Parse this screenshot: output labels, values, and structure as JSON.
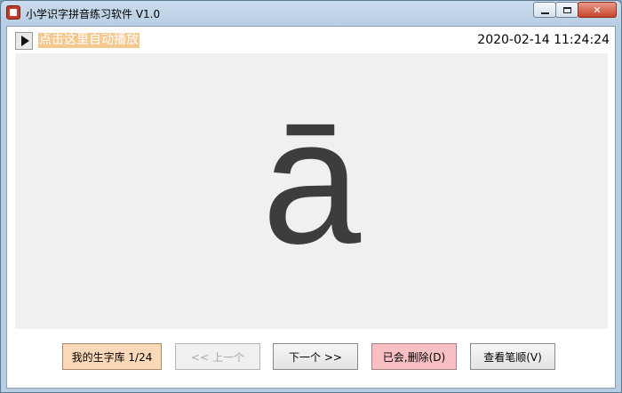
{
  "window": {
    "title": "小学识字拼音练习软件 V1.0",
    "close_glyph": "✕"
  },
  "toolbar": {
    "autoplay_label": "点击这里自动播放",
    "datetime": "2020-02-14 11:24:24"
  },
  "display": {
    "pinyin": "ā"
  },
  "buttons": {
    "word_bank": "我的生字库 1/24",
    "prev": "<< 上一个",
    "next": "下一个 >>",
    "learned_delete": "已会,删除(D)",
    "stroke_order": "查看笔顺(V)"
  },
  "colors": {
    "autoplay_bg": "#f4c98f",
    "word_bank_bg": "#fbd9b8",
    "delete_bg": "#f8c0c3",
    "pinyin_color": "#3d3d3d"
  }
}
